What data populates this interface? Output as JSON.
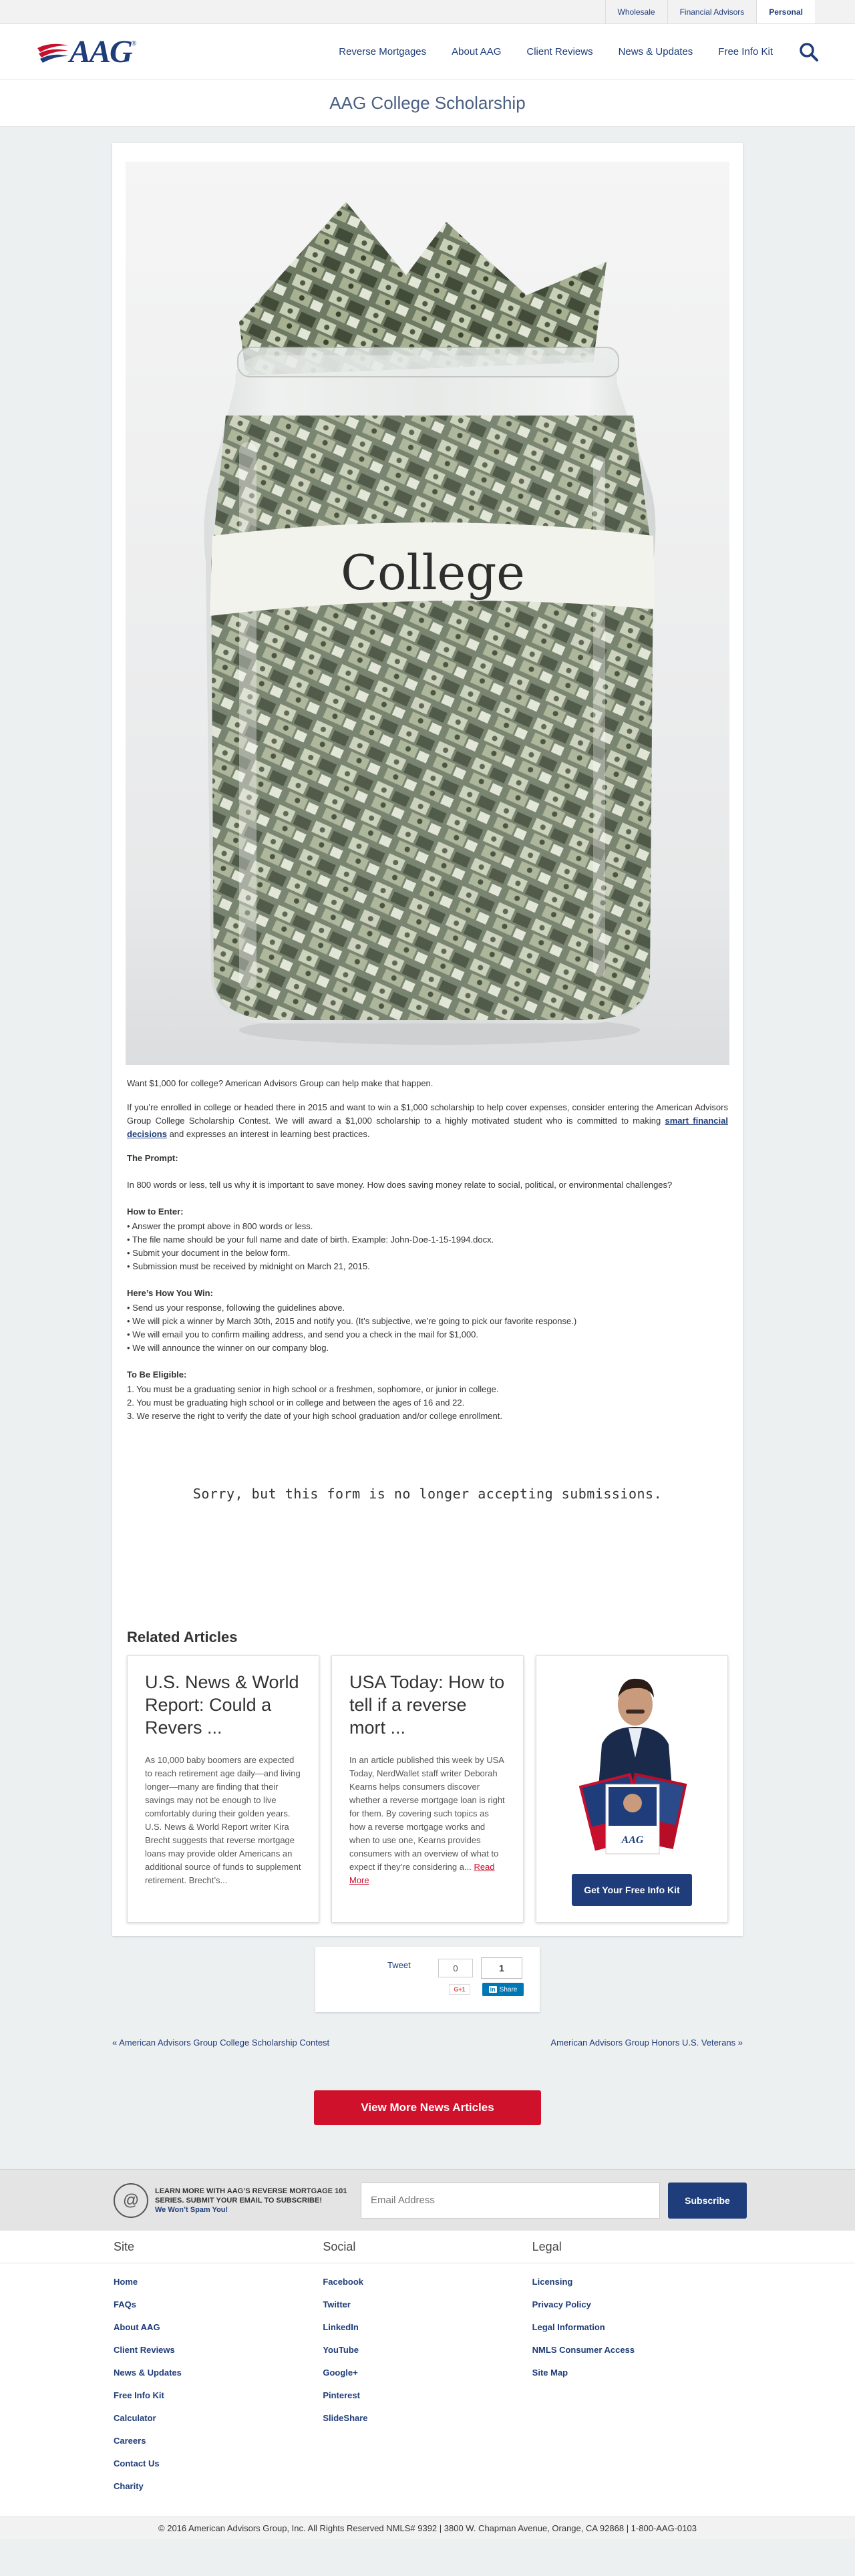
{
  "utility": {
    "links": [
      "Wholesale",
      "Financial Advisors",
      "Personal"
    ]
  },
  "header": {
    "logo_text": "AAG",
    "nav": [
      "Reverse Mortgages",
      "About AAG",
      "Client Reviews",
      "News & Updates",
      "Free Info Kit"
    ]
  },
  "page": {
    "title": "AAG College Scholarship"
  },
  "hero": {
    "jar_label": "College"
  },
  "article": {
    "intro": "Want $1,000 for college? American Advisors Group can help make that happen.",
    "para1_before": "If you’re enrolled in college or headed there in 2015 and want to win a $1,000 scholarship to help cover expenses, consider entering the American Advisors Group College Scholarship Contest. We will award a $1,000 scholarship to a highly motivated student who is committed to making ",
    "para1_link": "smart financial decisions",
    "para1_after": " and expresses an interest in learning best practices.",
    "prompt_heading": "The Prompt:",
    "prompt_text": "In 800 words or less, tell us why it is important to save money. How does saving money relate to social, political, or environmental challenges?",
    "enter_heading": "How to Enter:",
    "enter_items": [
      "• Answer the prompt above in 800 words or less.",
      "• The file name should be your full name and date of birth. Example: John-Doe-1-15-1994.docx.",
      "• Submit your document in the below form.",
      "• Submission must be received by midnight on March 21, 2015."
    ],
    "win_heading": "Here’s How You Win:",
    "win_items": [
      "• Send us your response, following the guidelines above.",
      "• We will pick a winner by March 30th, 2015 and notify you. (It’s subjective, we’re going to pick our favorite response.)",
      "• We will email you to confirm mailing address, and send you a check in the mail for $1,000.",
      "• We will announce the winner on our company blog."
    ],
    "eligible_heading": "To Be Eligible:",
    "eligible_items": [
      "1. You must be a graduating senior in high school or a freshmen, sophomore, or junior in college.",
      "2. You must be graduating high school or in college and between the ages of 16 and 22.",
      "3. We reserve the right to verify the date of your high school graduation and/or college enrollment."
    ],
    "closed_message": "Sorry, but this form is no longer accepting submissions."
  },
  "related": {
    "heading": "Related Articles",
    "items": [
      {
        "title": "U.S. News & World Report: Could a Revers ...",
        "excerpt": "As 10,000 baby boomers are expected to reach retirement age daily—and living longer—many are finding that their savings may not be enough to live comfortably during their golden years. U.S. News & World Report writer Kira Brecht suggests that reverse mortgage loans may provide older Americans an additional source of funds to supplement retirement. Brecht’s..."
      },
      {
        "title": "USA Today: How to tell if a reverse mort ...",
        "excerpt": "In an article published this week by USA Today, NerdWallet staff writer Deborah Kearns helps consumers discover whether a reverse mortgage loan is right for them. By covering such topics as how a reverse mortgage works and when to use one, Kearns provides consumers with an overview of what to expect if they’re considering a... ",
        "read_more": "Read More"
      }
    ],
    "kit_button": "Get Your Free Info Kit"
  },
  "share": {
    "tweet": "Tweet",
    "count_a": "0",
    "count_b": "1",
    "gplus": "G+1",
    "linkedin": "Share",
    "linkedin_badge": "in"
  },
  "post_nav": {
    "prev": "« American Advisors Group College Scholarship Contest",
    "next": "American Advisors Group Honors U.S. Veterans »"
  },
  "more_news": "View More News Articles",
  "newsletter": {
    "line1": "LEARN MORE WITH AAG’S REVERSE MORTGAGE 101 SERIES. SUBMIT YOUR EMAIL TO SUBSCRIBE!",
    "line2": "We Won’t Spam You!",
    "placeholder": "Email Address",
    "button": "Subscribe"
  },
  "footer": {
    "site_heading": "Site",
    "site_links": [
      "Home",
      "FAQs",
      "About AAG",
      "Client Reviews",
      "News & Updates",
      "Free Info Kit",
      "Calculator",
      "Careers",
      "Contact Us",
      "Charity"
    ],
    "social_heading": "Social",
    "social_links": [
      "Facebook",
      "Twitter",
      "LinkedIn",
      "YouTube",
      "Google+",
      "Pinterest",
      "SlideShare"
    ],
    "legal_heading": "Legal",
    "legal_links": [
      "Licensing",
      "Privacy Policy",
      "Legal Information",
      "NMLS Consumer Access",
      "Site Map"
    ],
    "copyright": "© 2016 American Advisors Group, Inc. All Rights Reserved NMLS# 9392 | 3800 W. Chapman Avenue, Orange, CA 92868 | 1-800-AAG-0103"
  },
  "colors": {
    "brand_navy": "#1f3d7a",
    "brand_red": "#d0112b",
    "page_bg": "#ecf0f1"
  },
  "icons": {
    "search": "search-icon",
    "newsletter": "at-sign-icon",
    "logo_swoosh": "flag-swoosh-icon"
  }
}
